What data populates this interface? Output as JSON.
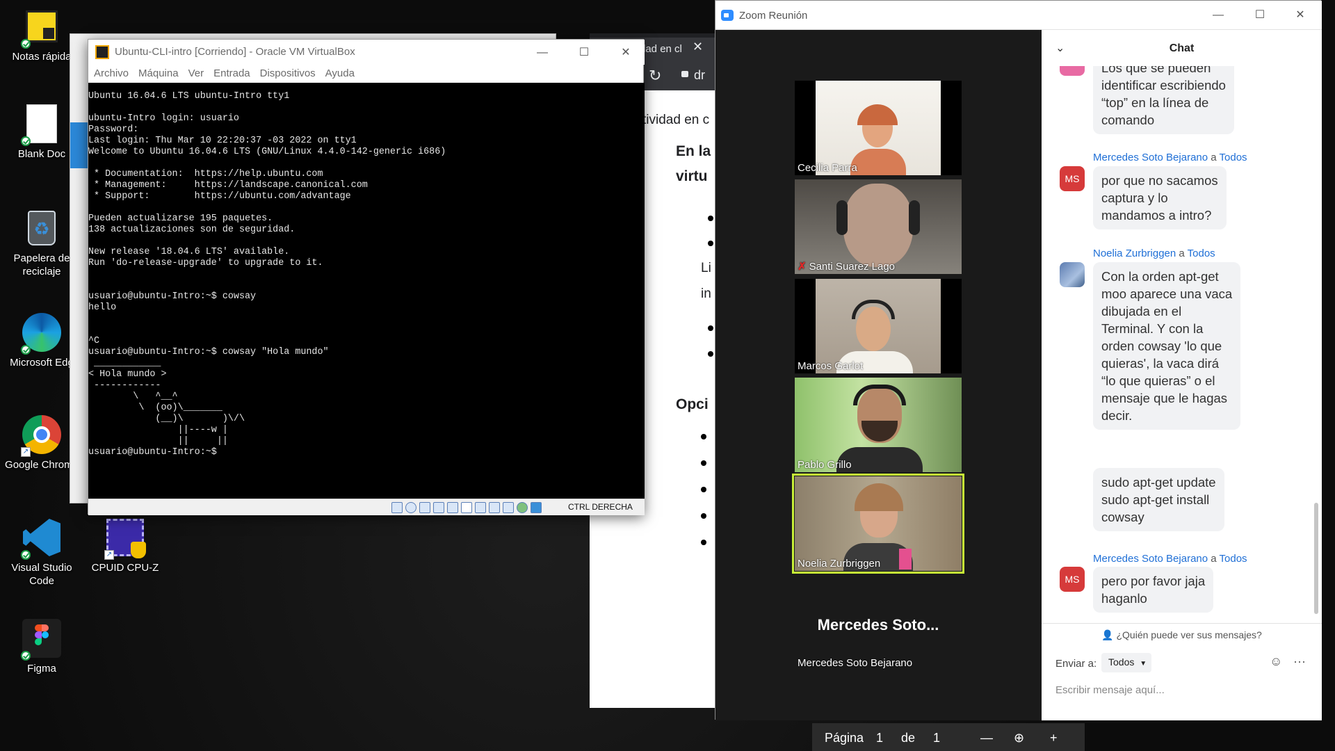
{
  "desktop": {
    "icons": [
      {
        "label": "Notas rápida",
        "icon": "sticky-notes-icon"
      },
      {
        "label": "Blank Doc",
        "icon": "document-icon"
      },
      {
        "label": "Papelera de reciclaje",
        "icon": "recycle-bin-icon"
      },
      {
        "label": "Microsoft Edg",
        "icon": "edge-icon"
      },
      {
        "label": "Google Chrome",
        "icon": "chrome-icon"
      },
      {
        "label": "Visual Studio Code",
        "icon": "vscode-icon"
      },
      {
        "label": "CPUID CPU-Z",
        "icon": "cpuz-icon"
      },
      {
        "label": "Figma",
        "icon": "figma-icon"
      }
    ]
  },
  "browser": {
    "tab_title": "dad en cl",
    "url_fragment": "dr",
    "doc_lines": [
      "tividad en c",
      "En la",
      "virtu",
      "Li",
      "in",
      "Opci"
    ]
  },
  "vbox": {
    "title": "Ubuntu-CLI-intro [Corriendo] - Oracle VM VirtualBox",
    "menu": [
      "Archivo",
      "Máquina",
      "Ver",
      "Entrada",
      "Dispositivos",
      "Ayuda"
    ],
    "host_key": "CTRL DERECHA",
    "terminal": "Ubuntu 16.04.6 LTS ubuntu-Intro tty1\n\nubuntu-Intro login: usuario\nPassword:\nLast login: Thu Mar 10 22:20:37 -03 2022 on tty1\nWelcome to Ubuntu 16.04.6 LTS (GNU/Linux 4.4.0-142-generic i686)\n\n * Documentation:  https://help.ubuntu.com\n * Management:     https://landscape.canonical.com\n * Support:        https://ubuntu.com/advantage\n\nPueden actualizarse 195 paquetes.\n138 actualizaciones son de seguridad.\n\nNew release '18.04.6 LTS' available.\nRun 'do-release-upgrade' to upgrade to it.\n\n\nusuario@ubuntu-Intro:~$ cowsay\nhello\n\n\n^C\nusuario@ubuntu-Intro:~$ cowsay \"Hola mundo\"\n ____________\n< Hola mundo >\n ------------\n        \\   ^__^\n         \\  (oo)\\_______\n            (__)\\       )\\/\\\n                ||----w |\n                ||     ||\nusuario@ubuntu-Intro:~$"
  },
  "zoom": {
    "title": "Zoom Reunión",
    "participants": [
      {
        "name": "Cecilia Parra",
        "muted": false,
        "active": false
      },
      {
        "name": "Santi Suarez Lago",
        "muted": true,
        "active": false
      },
      {
        "name": "Marcos Garlot",
        "muted": false,
        "active": false
      },
      {
        "name": "Pablo Grillo",
        "muted": false,
        "active": false
      },
      {
        "name": "Noelia Zurbriggen",
        "muted": false,
        "active": true
      },
      {
        "name": "Mercedes Soto Bejarano",
        "big_name": "Mercedes Soto...",
        "muted": false,
        "active": false
      }
    ],
    "chat": {
      "title": "Chat",
      "partial_message": "Los que se pueden\nidentificar escribiendo\n“top” en la línea de\ncomando",
      "messages": [
        {
          "sender": "Mercedes Soto Bejarano",
          "connector": "a",
          "to": "Todos",
          "initials": "MS",
          "texts": [
            "por que no sacamos\ncaptura y lo\nmandamos a intro?"
          ]
        },
        {
          "sender": "Noelia Zurbriggen",
          "connector": "a",
          "to": "Todos",
          "initials": "",
          "texts": [
            "Con la orden apt-get\nmoo aparece una vaca\ndibujada en el\nTerminal. Y con la\norden cowsay 'lo que\nquieras', la vaca dirá\n“lo que quieras” o el\nmensaje que le hagas\ndecir.",
            "sudo apt-get update\nsudo apt-get install\ncowsay"
          ]
        },
        {
          "sender": "Mercedes Soto Bejarano",
          "connector": "a",
          "to": "Todos",
          "initials": "MS",
          "texts": [
            "pero por favor jaja\nhaganlo"
          ]
        }
      ],
      "who_sees": "¿Quién puede ver sus mensajes?",
      "send_to_label": "Enviar a:",
      "send_to_value": "Todos",
      "input_placeholder": "Escribir mensaje aquí..."
    }
  },
  "pdf_nav": {
    "page_label": "Página",
    "page": "1",
    "of_label": "de",
    "total": "1"
  }
}
